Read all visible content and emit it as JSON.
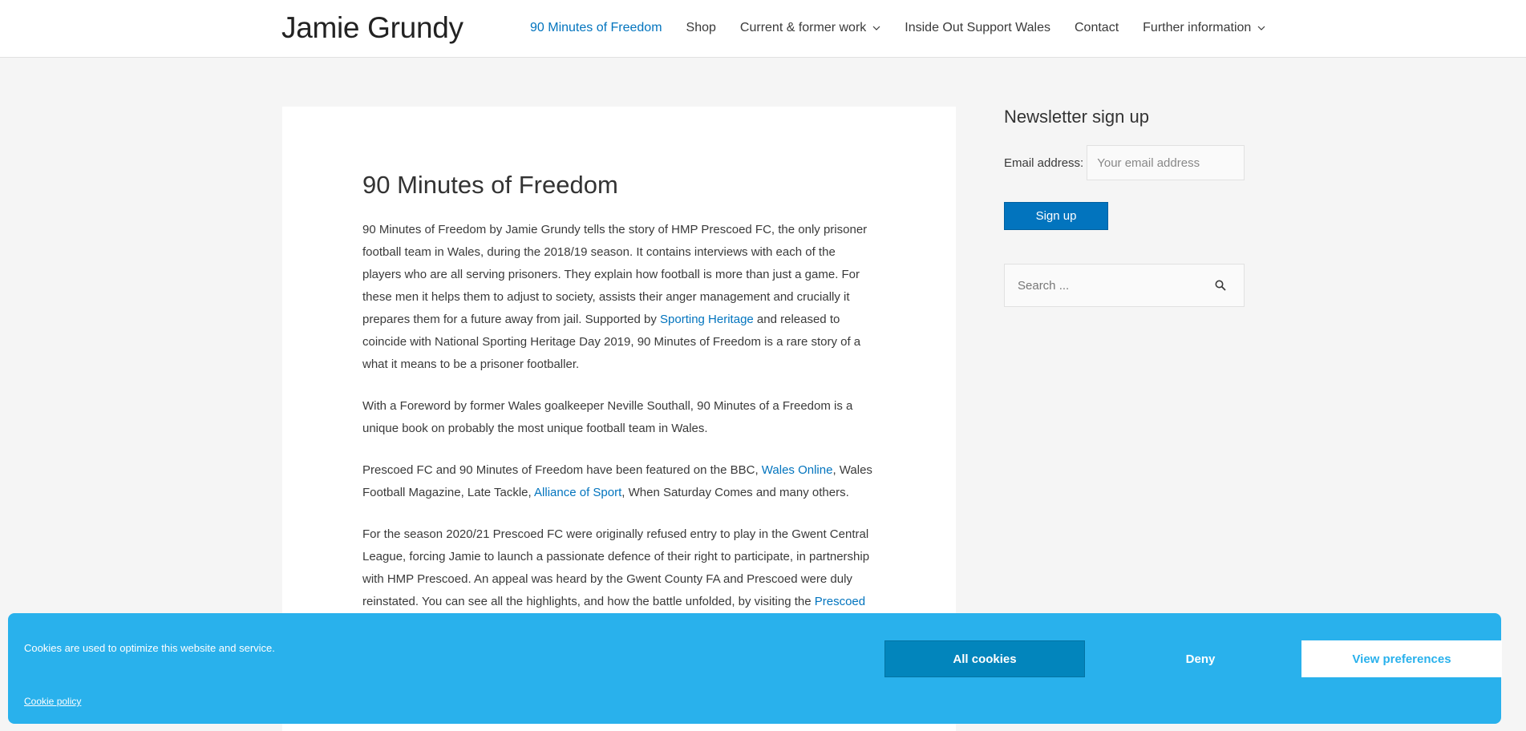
{
  "header": {
    "site_title": "Jamie Grundy",
    "nav": [
      {
        "label": "90 Minutes of Freedom",
        "active": true,
        "dropdown": false
      },
      {
        "label": "Shop",
        "active": false,
        "dropdown": false
      },
      {
        "label": "Current & former work",
        "active": false,
        "dropdown": true
      },
      {
        "label": "Inside Out Support Wales",
        "active": false,
        "dropdown": false
      },
      {
        "label": "Contact",
        "active": false,
        "dropdown": false
      },
      {
        "label": "Further information",
        "active": false,
        "dropdown": true
      }
    ]
  },
  "article": {
    "title": "90 Minutes of Freedom",
    "p1": {
      "text_a": "90 Minutes of Freedom by Jamie Grundy tells the story of HMP Prescoed FC, the only prisoner football team in Wales, during the 2018/19 season. It contains interviews with each of the players who are all serving prisoners. They explain how football is more than just a game. For these men it helps them to adjust to society, assists their anger management and crucially it prepares them for a future away from jail. Supported by ",
      "link": "Sporting Heritage",
      "text_b": " and released to coincide with National Sporting Heritage Day 2019, 90 Minutes of Freedom is a rare story of a what it means to be a prisoner footballer."
    },
    "p2": "With a Foreword by former Wales goalkeeper Neville Southall, 90 Minutes of a Freedom is a unique book on probably the most unique football team in Wales.",
    "p3": {
      "text_a": "Prescoed FC and 90 Minutes of Freedom have been featured on the BBC, ",
      "link_a": "Wales Online",
      "text_b": ", Wales Football Magazine, Late Tackle, ",
      "link_b": "Alliance of Sport",
      "text_c": ", When Saturday Comes and many others."
    },
    "p4": {
      "text_a": "For the season 2020/21 Prescoed FC were originally refused entry to play in the Gwent Central League, forcing Jamie to launch a passionate defence of their right to participate, in partnership with HMP Prescoed. An appeal was heard by the Gwent County FA and Prescoed were duly reinstated. You can see all the highlights, and how the battle unfolded, by visiting the ",
      "link": "Prescoed"
    }
  },
  "sidebar": {
    "newsletter_title": "Newsletter sign up",
    "email_label": "Email address:",
    "email_placeholder": "Your email address",
    "signup_label": "Sign up",
    "search_placeholder": "Search ..."
  },
  "cookie_banner": {
    "message": "Cookies are used to optimize this website and service.",
    "policy_link": "Cookie policy",
    "all_cookies": "All cookies",
    "deny": "Deny",
    "view_preferences": "View preferences"
  },
  "colors": {
    "accent": "#0274be",
    "cookie_banner": "#29b1ec",
    "cookie_all_button": "#0285bc",
    "page_background": "#f5f5f5"
  }
}
